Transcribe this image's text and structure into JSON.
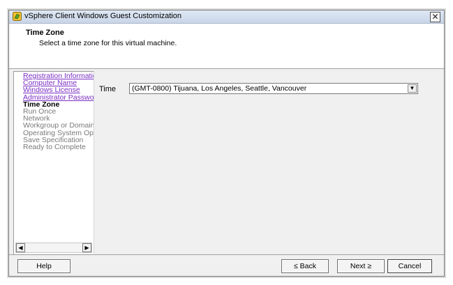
{
  "window": {
    "title": "vSphere Client Windows Guest Customization",
    "close_label": "✕"
  },
  "header": {
    "title": "Time Zone",
    "description": "Select a time zone for this virtual machine."
  },
  "nav": {
    "items": [
      {
        "label": "Registration Information",
        "state": "link"
      },
      {
        "label": "Computer Name",
        "state": "link"
      },
      {
        "label": "Windows License",
        "state": "link"
      },
      {
        "label": "Administrator Password",
        "state": "link"
      },
      {
        "label": "Time Zone",
        "state": "current"
      },
      {
        "label": "Run Once",
        "state": "pending"
      },
      {
        "label": "Network",
        "state": "pending"
      },
      {
        "label": "Workgroup or Domain",
        "state": "pending"
      },
      {
        "label": "Operating System Option",
        "state": "pending"
      },
      {
        "label": "Save Specification",
        "state": "pending"
      },
      {
        "label": "Ready to Complete",
        "state": "pending"
      }
    ],
    "scroll_left": "◀",
    "scroll_right": "▶"
  },
  "form": {
    "time_label": "Time",
    "time_value": "(GMT-0800) Tijuana, Los Angeles, Seattle, Vancouver",
    "dropdown_arrow": "▼"
  },
  "buttons": {
    "help": "Help",
    "back": "≤ Back",
    "next": "Next ≥",
    "cancel": "Cancel"
  },
  "colors": {
    "link": "#7b2fc4",
    "pending": "#7a7a7a"
  }
}
